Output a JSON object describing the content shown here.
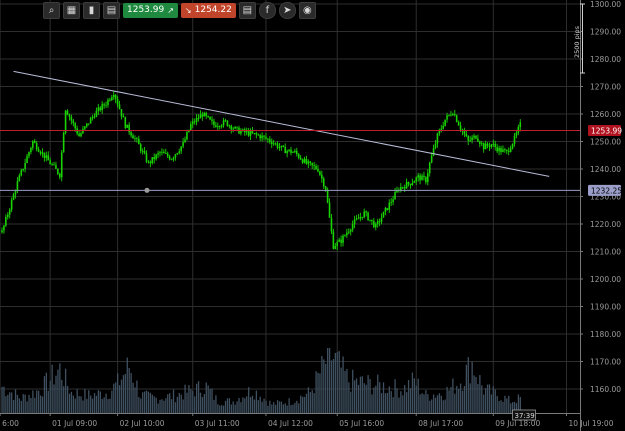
{
  "toolbar": {
    "sell_price": "1253.99",
    "buy_price": "1254.22",
    "icons": [
      "search-icon",
      "chart-settings-icon",
      "bar-chart-icon",
      "timeframe-icon",
      "sell-arrow-icon",
      "buy-arrow-icon",
      "hide-icon",
      "facebook-icon",
      "share-icon",
      "camera-icon"
    ]
  },
  "colors": {
    "background": "#000000",
    "grid": "#2e2e2e",
    "candle": "#19d400",
    "volume": "#3f5060",
    "bid_line": "#c0202e",
    "bid_label_bg": "#b0121f",
    "level_line": "#9a9ec8",
    "level_label_bg": "#9a9ec8",
    "trendline": "#b8bcd8",
    "axis_text": "#9a9a9a"
  },
  "chart_data": {
    "type": "candlestick",
    "symbol_timeframe": "",
    "ylim": [
      1152,
      1302
    ],
    "yticks": [
      1160,
      1170,
      1180,
      1190,
      1200,
      1210,
      1220,
      1230,
      1240,
      1250,
      1260,
      1270,
      1280,
      1290,
      1300
    ],
    "ytick_labels": [
      "1160.00",
      "1170.00",
      "1180.00",
      "1190.00",
      "1200.00",
      "1210.00",
      "1220.00",
      "1230.00",
      "1240.00",
      "1250.00",
      "1260.00",
      "1270.00",
      "1280.00",
      "1290.00",
      "1300.00"
    ],
    "xticks": [
      {
        "label": "6:00",
        "bar": -1
      },
      {
        "label": "01 Jul 09:00",
        "bar": 25
      },
      {
        "label": "02 Jul 10:00",
        "bar": 60
      },
      {
        "label": "03 Jul 11:00",
        "bar": 99
      },
      {
        "label": "04 Jul 12:00",
        "bar": 137
      },
      {
        "label": "05 Jul 16:00",
        "bar": 174
      },
      {
        "label": "08 Jul 17:00",
        "bar": 215
      },
      {
        "label": "09 Jul 18:00",
        "bar": 255
      },
      {
        "label": "10 Jul 19:00",
        "bar": 293
      }
    ],
    "bar_count": 270,
    "future_bars": 30,
    "anchors": [
      [
        0,
        1217
      ],
      [
        8,
        1235
      ],
      [
        16,
        1250
      ],
      [
        24,
        1243
      ],
      [
        30,
        1238
      ],
      [
        33,
        1262
      ],
      [
        40,
        1252
      ],
      [
        48,
        1260
      ],
      [
        54,
        1264
      ],
      [
        58,
        1268
      ],
      [
        64,
        1256
      ],
      [
        70,
        1250
      ],
      [
        76,
        1242
      ],
      [
        82,
        1246
      ],
      [
        88,
        1244
      ],
      [
        94,
        1249
      ],
      [
        98,
        1256
      ],
      [
        104,
        1260
      ],
      [
        110,
        1256
      ],
      [
        116,
        1257
      ],
      [
        122,
        1254
      ],
      [
        128,
        1253
      ],
      [
        134,
        1252
      ],
      [
        140,
        1250
      ],
      [
        146,
        1247
      ],
      [
        152,
        1246
      ],
      [
        158,
        1242
      ],
      [
        164,
        1240
      ],
      [
        168,
        1233
      ],
      [
        170,
        1222
      ],
      [
        172,
        1212
      ],
      [
        176,
        1214
      ],
      [
        182,
        1220
      ],
      [
        188,
        1224
      ],
      [
        194,
        1219
      ],
      [
        200,
        1226
      ],
      [
        206,
        1233
      ],
      [
        212,
        1235
      ],
      [
        216,
        1237
      ],
      [
        220,
        1236
      ],
      [
        222,
        1242
      ],
      [
        226,
        1252
      ],
      [
        230,
        1258
      ],
      [
        234,
        1261
      ],
      [
        238,
        1255
      ],
      [
        242,
        1250
      ],
      [
        246,
        1252
      ],
      [
        250,
        1248
      ],
      [
        254,
        1249
      ],
      [
        258,
        1247
      ],
      [
        262,
        1246
      ],
      [
        266,
        1251
      ],
      [
        269,
        1256
      ]
    ],
    "volume_anchors": [
      [
        0,
        0.45
      ],
      [
        10,
        0.25
      ],
      [
        20,
        0.4
      ],
      [
        30,
        0.75
      ],
      [
        36,
        0.35
      ],
      [
        45,
        0.3
      ],
      [
        55,
        0.35
      ],
      [
        60,
        0.5
      ],
      [
        66,
        0.8
      ],
      [
        72,
        0.3
      ],
      [
        80,
        0.25
      ],
      [
        90,
        0.3
      ],
      [
        100,
        0.4
      ],
      [
        106,
        0.45
      ],
      [
        112,
        0.2
      ],
      [
        120,
        0.2
      ],
      [
        130,
        0.4
      ],
      [
        140,
        0.15
      ],
      [
        150,
        0.2
      ],
      [
        160,
        0.35
      ],
      [
        170,
        1.0
      ],
      [
        174,
        0.85
      ],
      [
        180,
        0.55
      ],
      [
        190,
        0.5
      ],
      [
        200,
        0.45
      ],
      [
        208,
        0.4
      ],
      [
        214,
        0.55
      ],
      [
        220,
        0.3
      ],
      [
        230,
        0.35
      ],
      [
        238,
        0.55
      ],
      [
        244,
        0.85
      ],
      [
        250,
        0.4
      ],
      [
        258,
        0.3
      ],
      [
        264,
        0.2
      ],
      [
        269,
        0.25
      ]
    ],
    "bid_price": 1253.99,
    "bid_label": "1253.99",
    "level_price": 1232.25,
    "level_label": "1232.25",
    "trendline": {
      "start_bar": 6,
      "start_price": 1275.5,
      "end_bar": 284,
      "end_price": 1237.3
    },
    "range_marker_label": "2500 pips",
    "countdown_label": "37:39"
  }
}
